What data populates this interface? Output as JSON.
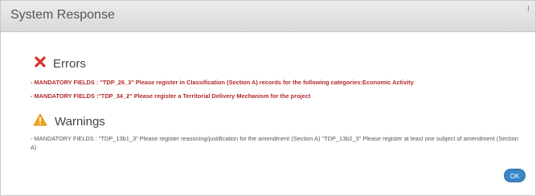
{
  "dialog": {
    "title": "System Response",
    "close_glyph": "I"
  },
  "errors": {
    "icon": "x-icon",
    "icon_color": "#d9302a",
    "heading": "Errors",
    "messages": [
      "- MANDATORY FIELDS : \"TDP_26_3\" Please register in Classification (Section A) records for the following categories:Economic Activity",
      "- MANDATORY FIELDS :\"TDP_34_2\" Please register a Territorial Delivery Mechanism for the project"
    ]
  },
  "warnings": {
    "icon": "warning-triangle-icon",
    "icon_color": "#f0a31c",
    "heading": "Warnings",
    "messages": [
      "- MANDATORY FIELDS : \"TDP_13b1_3\" Please register reasoning/justification for the amendment (Section A) \"TDP_13b2_3\" Please register at least one subject of amendment (Section A)"
    ]
  },
  "actions": {
    "ok_label": "OK",
    "ok_color": "#3a86c8"
  }
}
